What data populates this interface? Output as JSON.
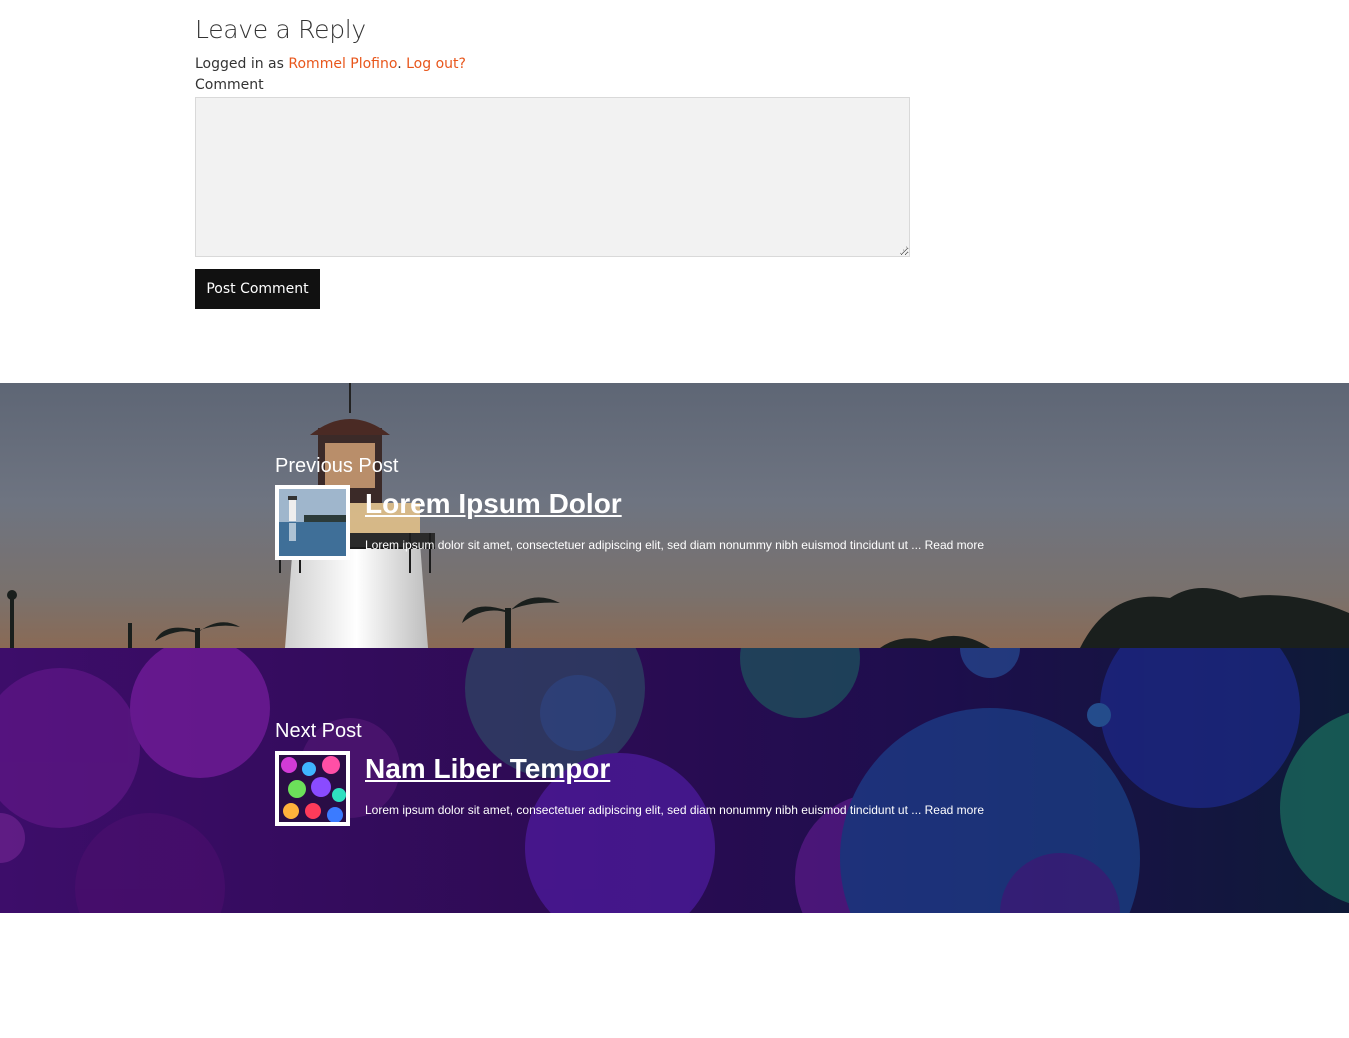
{
  "reply": {
    "title": "Leave a Reply",
    "logged_prefix": "Logged in as",
    "user_name": "Rommel Plofino",
    "separator": ".",
    "logout_label": "Log out?",
    "comment_label": "Comment",
    "comment_value": "",
    "submit_label": "Post Comment"
  },
  "previous": {
    "label": "Previous Post",
    "title": "Lorem Ipsum Dolor",
    "excerpt": "Lorem ipsum dolor sit amet, consectetuer adipiscing elit, sed diam nonummy nibh euismod tincidunt ut ...",
    "read_more": "Read more",
    "thumbnail": "lighthouse-thumbnail"
  },
  "next": {
    "label": "Next Post",
    "title": "Nam Liber Tempor",
    "excerpt": "Lorem ipsum dolor sit amet, consectetuer adipiscing elit, sed diam nonummy nibh euismod tincidunt ut ...",
    "read_more": "Read more",
    "thumbnail": "bokeh-thumbnail"
  },
  "colors": {
    "link": "#e8561b",
    "button_bg": "#111111",
    "textarea_bg": "#f2f2f2"
  }
}
